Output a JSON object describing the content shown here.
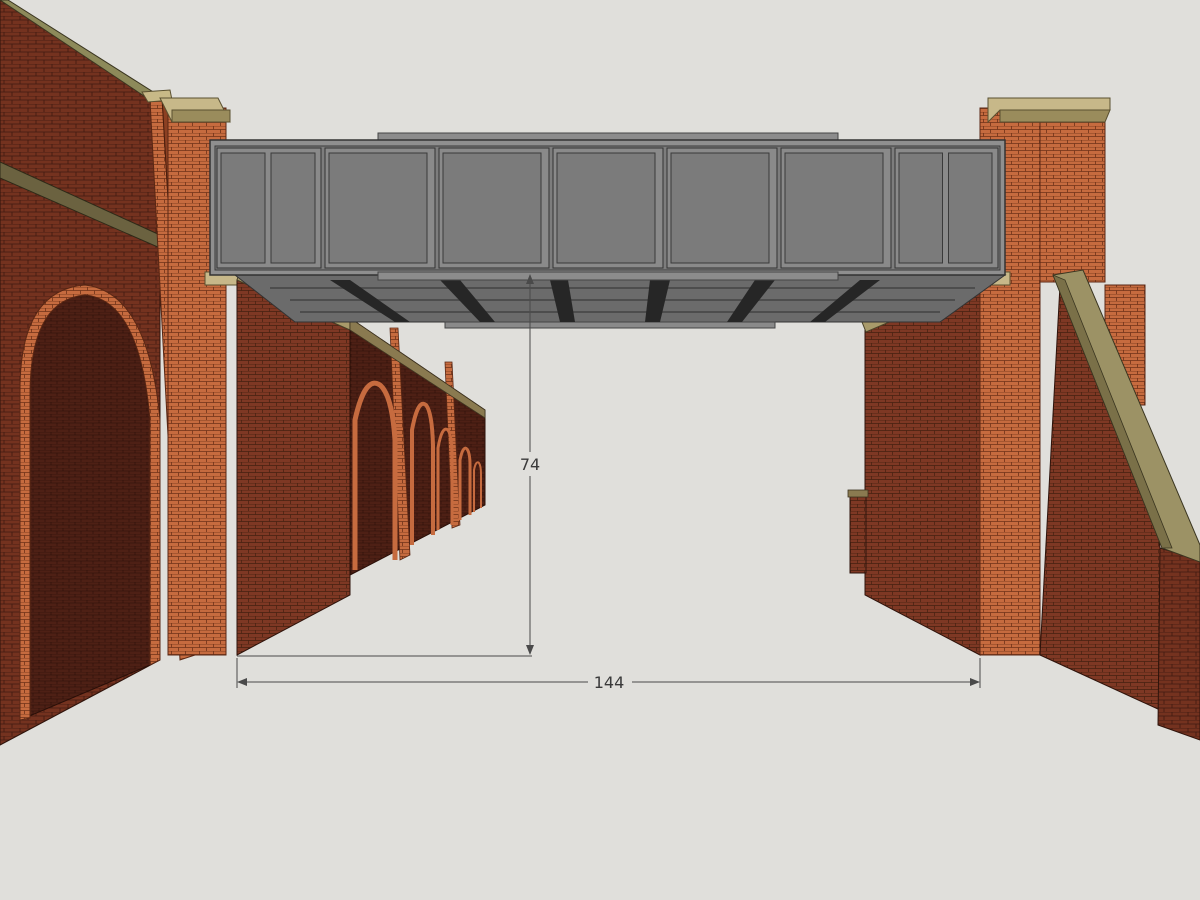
{
  "dimensions": {
    "clearance_height": "74",
    "span_width": "144"
  },
  "colors": {
    "background": "#e0dfdb",
    "brick_dark": "#6b2e1d",
    "brick_face": "#7a3522",
    "pier_brick": "#c46a3e",
    "coping": "#b7aa76",
    "girder": "#7b7b7b",
    "girder_frame": "#8e8e8e",
    "deck_beam": "#2a2a2a",
    "dimension_line": "#4a4a4a"
  }
}
